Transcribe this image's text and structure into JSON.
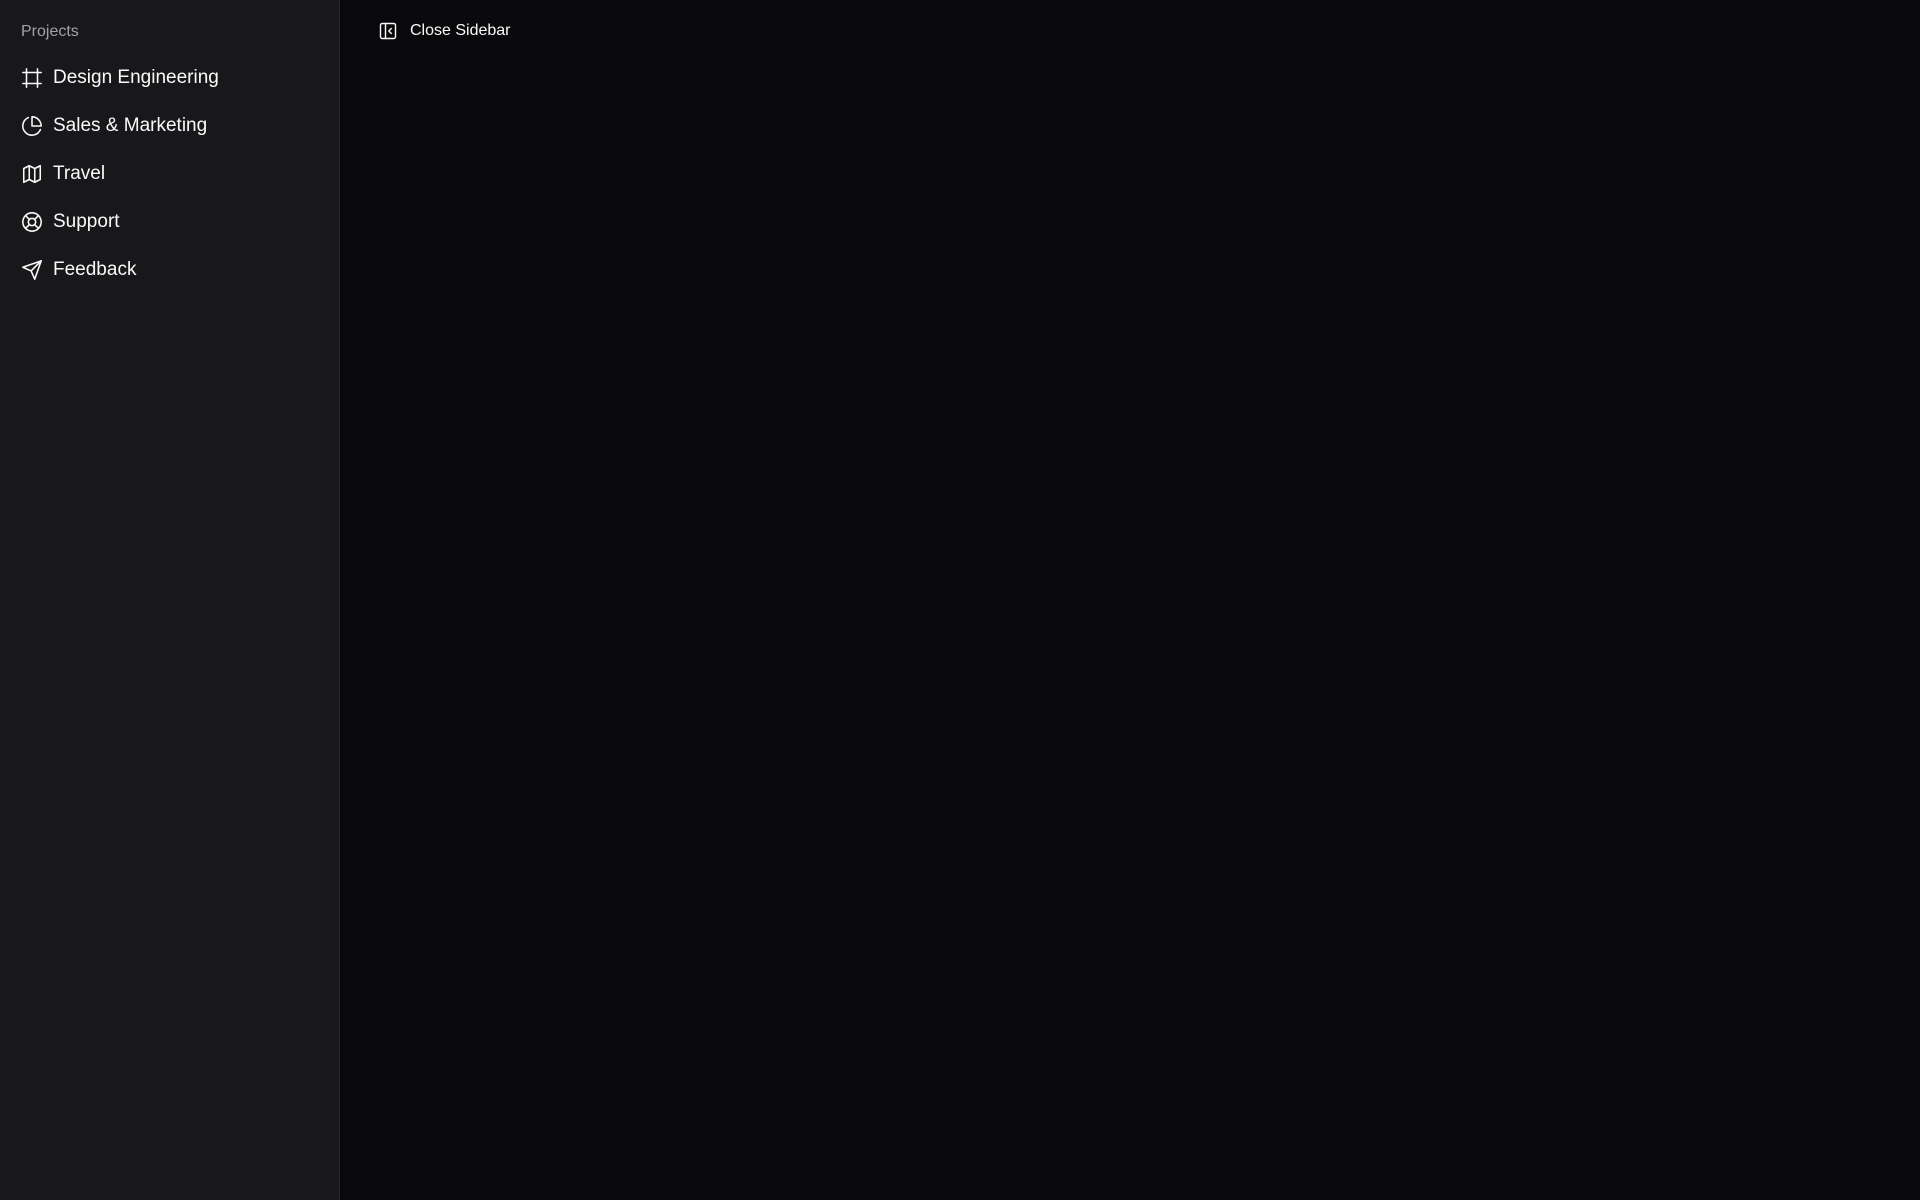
{
  "sidebar": {
    "group_label": "Projects",
    "items": [
      {
        "label": "Design Engineering",
        "icon": "frame-icon"
      },
      {
        "label": "Sales & Marketing",
        "icon": "pie-chart-icon"
      },
      {
        "label": "Travel",
        "icon": "map-icon"
      },
      {
        "label": "Support",
        "icon": "life-buoy-icon"
      },
      {
        "label": "Feedback",
        "icon": "send-icon"
      }
    ]
  },
  "toolbar": {
    "close_sidebar_label": "Close Sidebar",
    "close_sidebar_icon": "panel-left-close-icon"
  },
  "colors": {
    "sidebar_bg": "#18181b",
    "main_bg": "#09090b",
    "text": "#fafafa",
    "muted_text": "#a1a1aa",
    "border": "#27272a"
  }
}
